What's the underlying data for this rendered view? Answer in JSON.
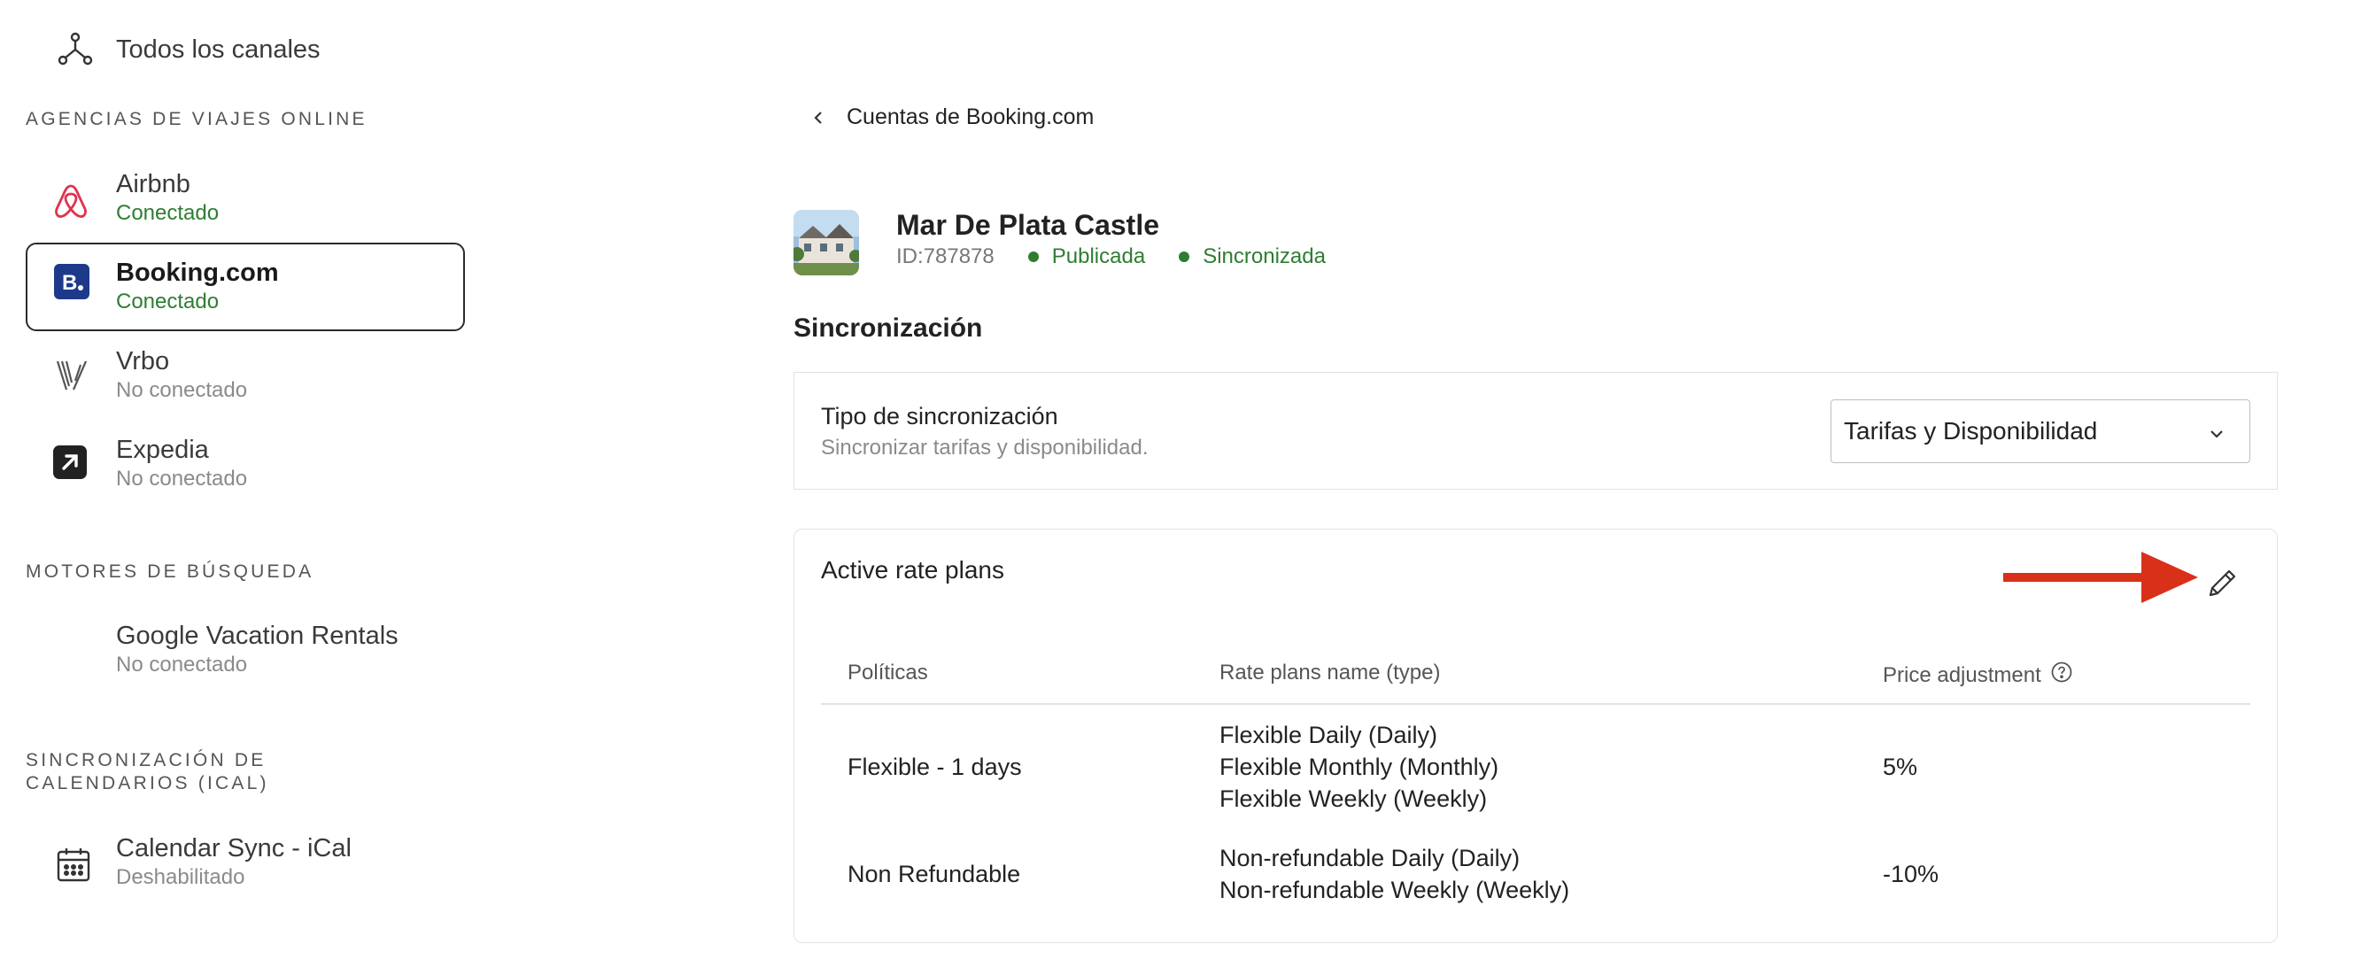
{
  "sidebar": {
    "all_channels": {
      "label": "Todos los canales",
      "icon": "channels-icon"
    },
    "sections": {
      "ota": "AGENCIAS DE VIAJES ONLINE",
      "search": "MOTORES DE BÚSQUEDA",
      "ical": "SINCRONIZACIÓN DE CALENDARIOS (ICAL)"
    },
    "channels": [
      {
        "name": "Airbnb",
        "status": "Conectado",
        "icon": "airbnb-icon"
      },
      {
        "name": "Booking.com",
        "status": "Conectado",
        "icon": "booking-icon",
        "selected": true
      },
      {
        "name": "Vrbo",
        "status": "No conectado",
        "icon": "vrbo-icon"
      },
      {
        "name": "Expedia",
        "status": "No conectado",
        "icon": "expedia-icon"
      },
      {
        "name": "Google Vacation Rentals",
        "status": "No conectado"
      },
      {
        "name": "Calendar Sync - iCal",
        "status": "Deshabilitado",
        "icon": "calendar-icon"
      }
    ]
  },
  "main": {
    "back_label": "Cuentas de Booking.com",
    "property": {
      "name": "Mar De Plata Castle",
      "id": "ID:787878",
      "status_published": "Publicada",
      "status_synced": "Sincronizada"
    },
    "sync_section_title": "Sincronización",
    "sync_type": {
      "label": "Tipo de sincronización",
      "description": "Sincronizar tarifas y disponibilidad.",
      "selected": "Tarifas y Disponibilidad"
    },
    "rate_plans": {
      "title": "Active rate plans",
      "columns": [
        "Políticas",
        "Rate plans name (type)",
        "Price adjustment"
      ],
      "rows": [
        {
          "policy": "Flexible - 1 days",
          "plans": [
            "Flexible Daily (Daily)",
            "Flexible Monthly (Monthly)",
            "Flexible Weekly (Weekly)"
          ],
          "adjustment": "5%"
        },
        {
          "policy": "Non Refundable",
          "plans": [
            "Non-refundable Daily (Daily)",
            "Non-refundable Weekly (Weekly)"
          ],
          "adjustment": "-10%"
        }
      ]
    }
  },
  "colors": {
    "connected_green": "#2e7d32",
    "annotation_arrow": "#d9301a",
    "booking_brand": "#1d3a8a",
    "airbnb_brand": "#e0334f"
  }
}
